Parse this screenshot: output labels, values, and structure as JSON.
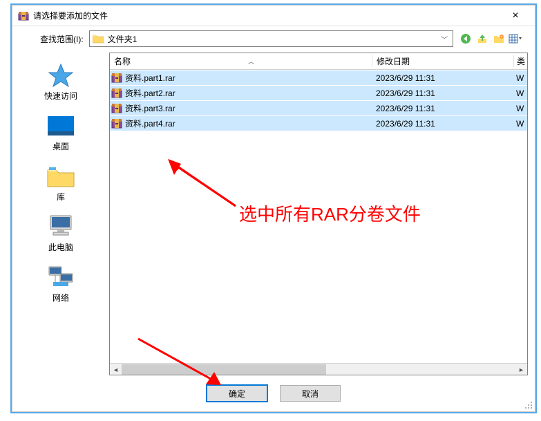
{
  "window": {
    "title": "请选择要添加的文件",
    "close": "×"
  },
  "path": {
    "label": "查找范围(I):",
    "current": "文件夹1"
  },
  "places": [
    {
      "label": "快速访问"
    },
    {
      "label": "桌面"
    },
    {
      "label": "库"
    },
    {
      "label": "此电脑"
    },
    {
      "label": "网络"
    }
  ],
  "columns": {
    "name": "名称",
    "date": "修改日期",
    "type": "类"
  },
  "files": [
    {
      "name": "资料.part1.rar",
      "date": "2023/6/29 11:31",
      "type": "W"
    },
    {
      "name": "资料.part2.rar",
      "date": "2023/6/29 11:31",
      "type": "W"
    },
    {
      "name": "资料.part3.rar",
      "date": "2023/6/29 11:31",
      "type": "W"
    },
    {
      "name": "资料.part4.rar",
      "date": "2023/6/29 11:31",
      "type": "W"
    }
  ],
  "buttons": {
    "ok": "确定",
    "cancel": "取消"
  },
  "annotation": {
    "text": "选中所有RAR分卷文件"
  }
}
